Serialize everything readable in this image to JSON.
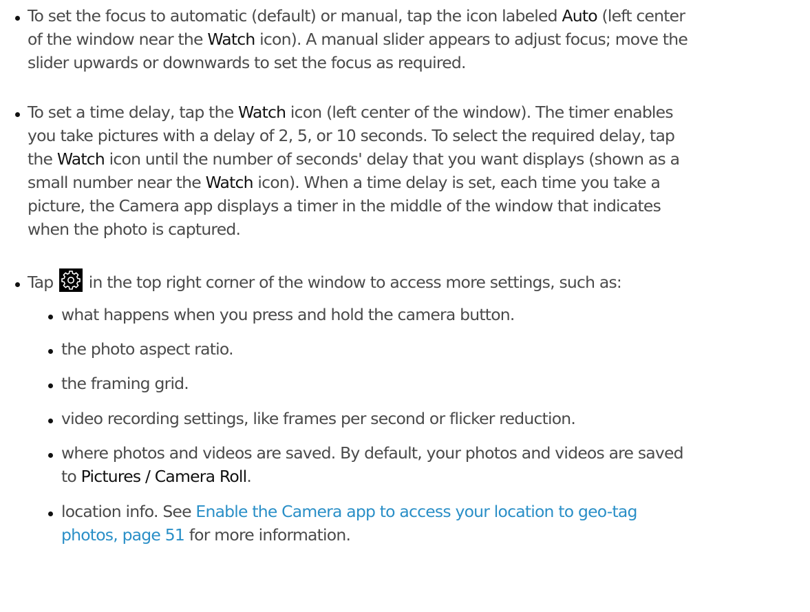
{
  "bullets": [
    {
      "p1": "To set the focus to automatic (default) or manual, tap the icon labeled ",
      "auto": "Auto",
      "p2": " (left center",
      "p3": "of the window near the ",
      "watch": "Watch",
      "p4": " icon). A manual slider appears to adjust focus; move the",
      "p5": "slider upwards or downwards to set the focus as required."
    },
    {
      "p1": "To set a time delay, tap the ",
      "watch1": "Watch",
      "p2": " icon (left center of the window). The timer enables",
      "p3": "you take pictures with a delay of 2, 5, or 10 seconds. To select the required delay, tap",
      "p4": "the ",
      "watch2": "Watch",
      "p5": " icon until the number of seconds' delay that you want displays (shown as a",
      "p6": "small number near the ",
      "watch3": "Watch",
      "p7": " icon). When a time delay is set, each time you take a",
      "p8": "picture, the Camera app displays a timer in the middle of the window that indicates",
      "p9": "when the photo is captured."
    },
    {
      "p1": "Tap ",
      "icon": "settings-gear-icon",
      "p2": " in the top right corner of the window to access more settings, such as:"
    }
  ],
  "subitems": [
    "what happens when you press and hold the camera button.",
    "the photo aspect ratio.",
    "the framing grid.",
    "video recording settings, like frames per second or flicker reduction."
  ],
  "saved": {
    "p1": "where photos and videos are saved. By default, your photos and videos are saved",
    "p2": "to ",
    "path": "Pictures / Camera Roll",
    "p3": "."
  },
  "location": {
    "p1": "location info. See ",
    "link1": "Enable the Camera app to access your location to geo-tag",
    "link2": "photos, page 51",
    "p2": " for more information."
  }
}
